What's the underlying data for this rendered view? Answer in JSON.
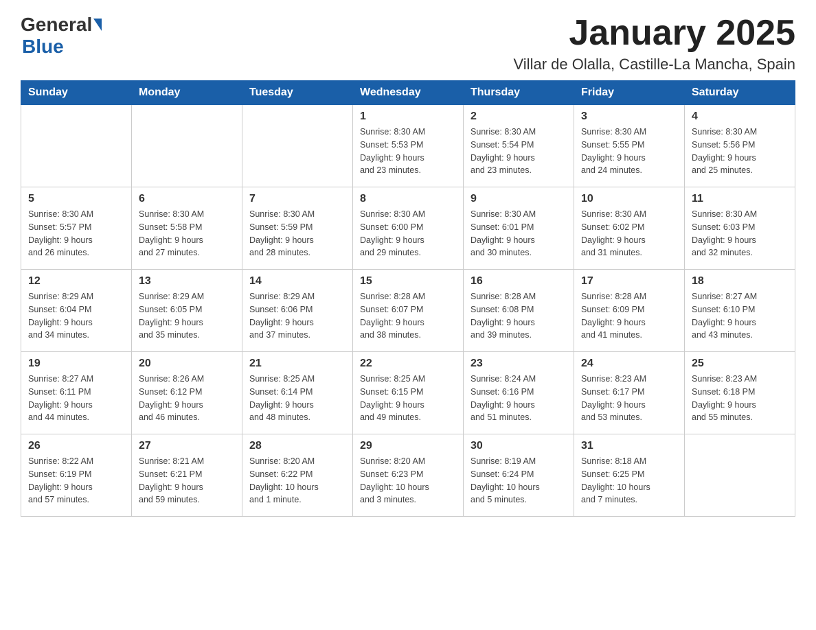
{
  "header": {
    "logo_general": "General",
    "logo_blue": "Blue",
    "month_title": "January 2025",
    "location": "Villar de Olalla, Castille-La Mancha, Spain"
  },
  "weekdays": [
    "Sunday",
    "Monday",
    "Tuesday",
    "Wednesday",
    "Thursday",
    "Friday",
    "Saturday"
  ],
  "weeks": [
    [
      {
        "day": "",
        "info": ""
      },
      {
        "day": "",
        "info": ""
      },
      {
        "day": "",
        "info": ""
      },
      {
        "day": "1",
        "info": "Sunrise: 8:30 AM\nSunset: 5:53 PM\nDaylight: 9 hours\nand 23 minutes."
      },
      {
        "day": "2",
        "info": "Sunrise: 8:30 AM\nSunset: 5:54 PM\nDaylight: 9 hours\nand 23 minutes."
      },
      {
        "day": "3",
        "info": "Sunrise: 8:30 AM\nSunset: 5:55 PM\nDaylight: 9 hours\nand 24 minutes."
      },
      {
        "day": "4",
        "info": "Sunrise: 8:30 AM\nSunset: 5:56 PM\nDaylight: 9 hours\nand 25 minutes."
      }
    ],
    [
      {
        "day": "5",
        "info": "Sunrise: 8:30 AM\nSunset: 5:57 PM\nDaylight: 9 hours\nand 26 minutes."
      },
      {
        "day": "6",
        "info": "Sunrise: 8:30 AM\nSunset: 5:58 PM\nDaylight: 9 hours\nand 27 minutes."
      },
      {
        "day": "7",
        "info": "Sunrise: 8:30 AM\nSunset: 5:59 PM\nDaylight: 9 hours\nand 28 minutes."
      },
      {
        "day": "8",
        "info": "Sunrise: 8:30 AM\nSunset: 6:00 PM\nDaylight: 9 hours\nand 29 minutes."
      },
      {
        "day": "9",
        "info": "Sunrise: 8:30 AM\nSunset: 6:01 PM\nDaylight: 9 hours\nand 30 minutes."
      },
      {
        "day": "10",
        "info": "Sunrise: 8:30 AM\nSunset: 6:02 PM\nDaylight: 9 hours\nand 31 minutes."
      },
      {
        "day": "11",
        "info": "Sunrise: 8:30 AM\nSunset: 6:03 PM\nDaylight: 9 hours\nand 32 minutes."
      }
    ],
    [
      {
        "day": "12",
        "info": "Sunrise: 8:29 AM\nSunset: 6:04 PM\nDaylight: 9 hours\nand 34 minutes."
      },
      {
        "day": "13",
        "info": "Sunrise: 8:29 AM\nSunset: 6:05 PM\nDaylight: 9 hours\nand 35 minutes."
      },
      {
        "day": "14",
        "info": "Sunrise: 8:29 AM\nSunset: 6:06 PM\nDaylight: 9 hours\nand 37 minutes."
      },
      {
        "day": "15",
        "info": "Sunrise: 8:28 AM\nSunset: 6:07 PM\nDaylight: 9 hours\nand 38 minutes."
      },
      {
        "day": "16",
        "info": "Sunrise: 8:28 AM\nSunset: 6:08 PM\nDaylight: 9 hours\nand 39 minutes."
      },
      {
        "day": "17",
        "info": "Sunrise: 8:28 AM\nSunset: 6:09 PM\nDaylight: 9 hours\nand 41 minutes."
      },
      {
        "day": "18",
        "info": "Sunrise: 8:27 AM\nSunset: 6:10 PM\nDaylight: 9 hours\nand 43 minutes."
      }
    ],
    [
      {
        "day": "19",
        "info": "Sunrise: 8:27 AM\nSunset: 6:11 PM\nDaylight: 9 hours\nand 44 minutes."
      },
      {
        "day": "20",
        "info": "Sunrise: 8:26 AM\nSunset: 6:12 PM\nDaylight: 9 hours\nand 46 minutes."
      },
      {
        "day": "21",
        "info": "Sunrise: 8:25 AM\nSunset: 6:14 PM\nDaylight: 9 hours\nand 48 minutes."
      },
      {
        "day": "22",
        "info": "Sunrise: 8:25 AM\nSunset: 6:15 PM\nDaylight: 9 hours\nand 49 minutes."
      },
      {
        "day": "23",
        "info": "Sunrise: 8:24 AM\nSunset: 6:16 PM\nDaylight: 9 hours\nand 51 minutes."
      },
      {
        "day": "24",
        "info": "Sunrise: 8:23 AM\nSunset: 6:17 PM\nDaylight: 9 hours\nand 53 minutes."
      },
      {
        "day": "25",
        "info": "Sunrise: 8:23 AM\nSunset: 6:18 PM\nDaylight: 9 hours\nand 55 minutes."
      }
    ],
    [
      {
        "day": "26",
        "info": "Sunrise: 8:22 AM\nSunset: 6:19 PM\nDaylight: 9 hours\nand 57 minutes."
      },
      {
        "day": "27",
        "info": "Sunrise: 8:21 AM\nSunset: 6:21 PM\nDaylight: 9 hours\nand 59 minutes."
      },
      {
        "day": "28",
        "info": "Sunrise: 8:20 AM\nSunset: 6:22 PM\nDaylight: 10 hours\nand 1 minute."
      },
      {
        "day": "29",
        "info": "Sunrise: 8:20 AM\nSunset: 6:23 PM\nDaylight: 10 hours\nand 3 minutes."
      },
      {
        "day": "30",
        "info": "Sunrise: 8:19 AM\nSunset: 6:24 PM\nDaylight: 10 hours\nand 5 minutes."
      },
      {
        "day": "31",
        "info": "Sunrise: 8:18 AM\nSunset: 6:25 PM\nDaylight: 10 hours\nand 7 minutes."
      },
      {
        "day": "",
        "info": ""
      }
    ]
  ]
}
